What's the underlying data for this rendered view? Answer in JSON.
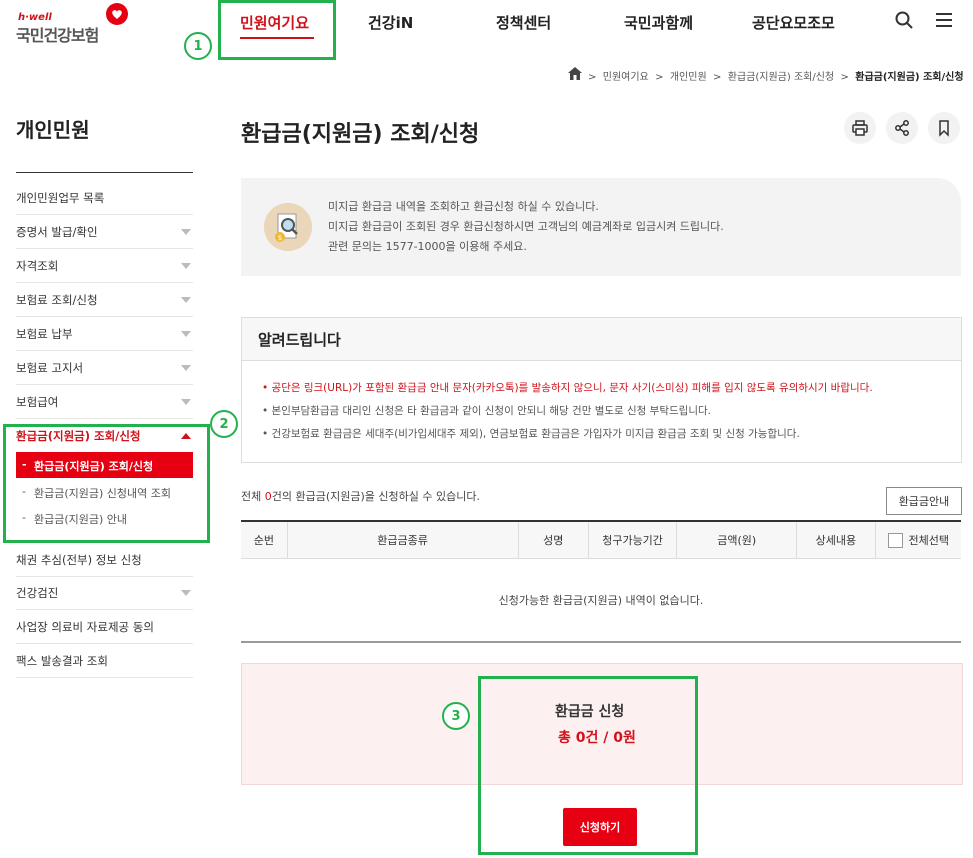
{
  "header": {
    "logo_small": "h·well",
    "logo_main": "국민건강보험",
    "nav": [
      "민원여기요",
      "건강iN",
      "정책센터",
      "국민과함께",
      "공단요모조모"
    ]
  },
  "breadcrumb": [
    "민원여기요",
    "개인민원",
    "환급금(지원금) 조회/신청",
    "환급금(지원금) 조회/신청"
  ],
  "sidebar": {
    "title": "개인민원",
    "items": [
      "개인민원업무 목록",
      "증명서 발급/확인",
      "자격조회",
      "보험료 조회/신청",
      "보험료 납부",
      "보험료 고지서",
      "보험급여",
      "환급금(지원금) 조회/신청"
    ],
    "subitems": [
      "환급금(지원금) 조회/신청",
      "환급금(지원금) 신청내역 조회",
      "환급금(지원금) 안내"
    ],
    "items_after": [
      "채권 추심(전부) 정보 신청",
      "건강검진",
      "사업장 의료비 자료제공 동의",
      "팩스 발송결과 조회"
    ]
  },
  "page": {
    "title": "환급금(지원금) 조회/신청",
    "intro": [
      "미지급 환급금 내역을 조회하고 환급신청 하실 수 있습니다.",
      "미지급 환급금이 조회된 경우 환급신청하시면 고객님의 예금계좌로 입금시켜 드립니다.",
      "관련 문의는 1577-1000을 이용해 주세요."
    ],
    "notice_title": "알려드립니다",
    "notices": [
      "공단은 링크(URL)가 포함된 환급금 안내 문자(카카오톡)를 발송하지 않으니, 문자 사기(스미싱) 피해를 입지 않도록 유의하시기 바랍니다.",
      "본인부담환급금 대리인 신청은 타 환급금과 같이 신청이 안되니 해당 건만 별도로 신청 부탁드립니다.",
      "건강보험료 환급금은 세대주(비가입세대주 제외), 연금보험료 환급금은 가입자가 미지급 환급금 조회 및 신청 가능합니다."
    ],
    "total_prefix": "전체 ",
    "total_count": "0",
    "total_suffix": "건의 환급금(지원금)을 신청하실 수 있습니다.",
    "guide_button": "환급금안내",
    "table_headers": [
      "순번",
      "환급금종류",
      "성명",
      "청구가능기간",
      "금액(원)",
      "상세내용",
      "전체선택"
    ],
    "empty_message": "신청가능한 환급금(지원금) 내역이 없습니다.",
    "apply_title": "환급금 신청",
    "apply_count": "총 0건 / 0원",
    "apply_button": "신청하기"
  },
  "annotations": [
    "1",
    "2",
    "3"
  ],
  "colors": {
    "brand_red": "#d0121b",
    "annotation_green": "#22b14c"
  }
}
